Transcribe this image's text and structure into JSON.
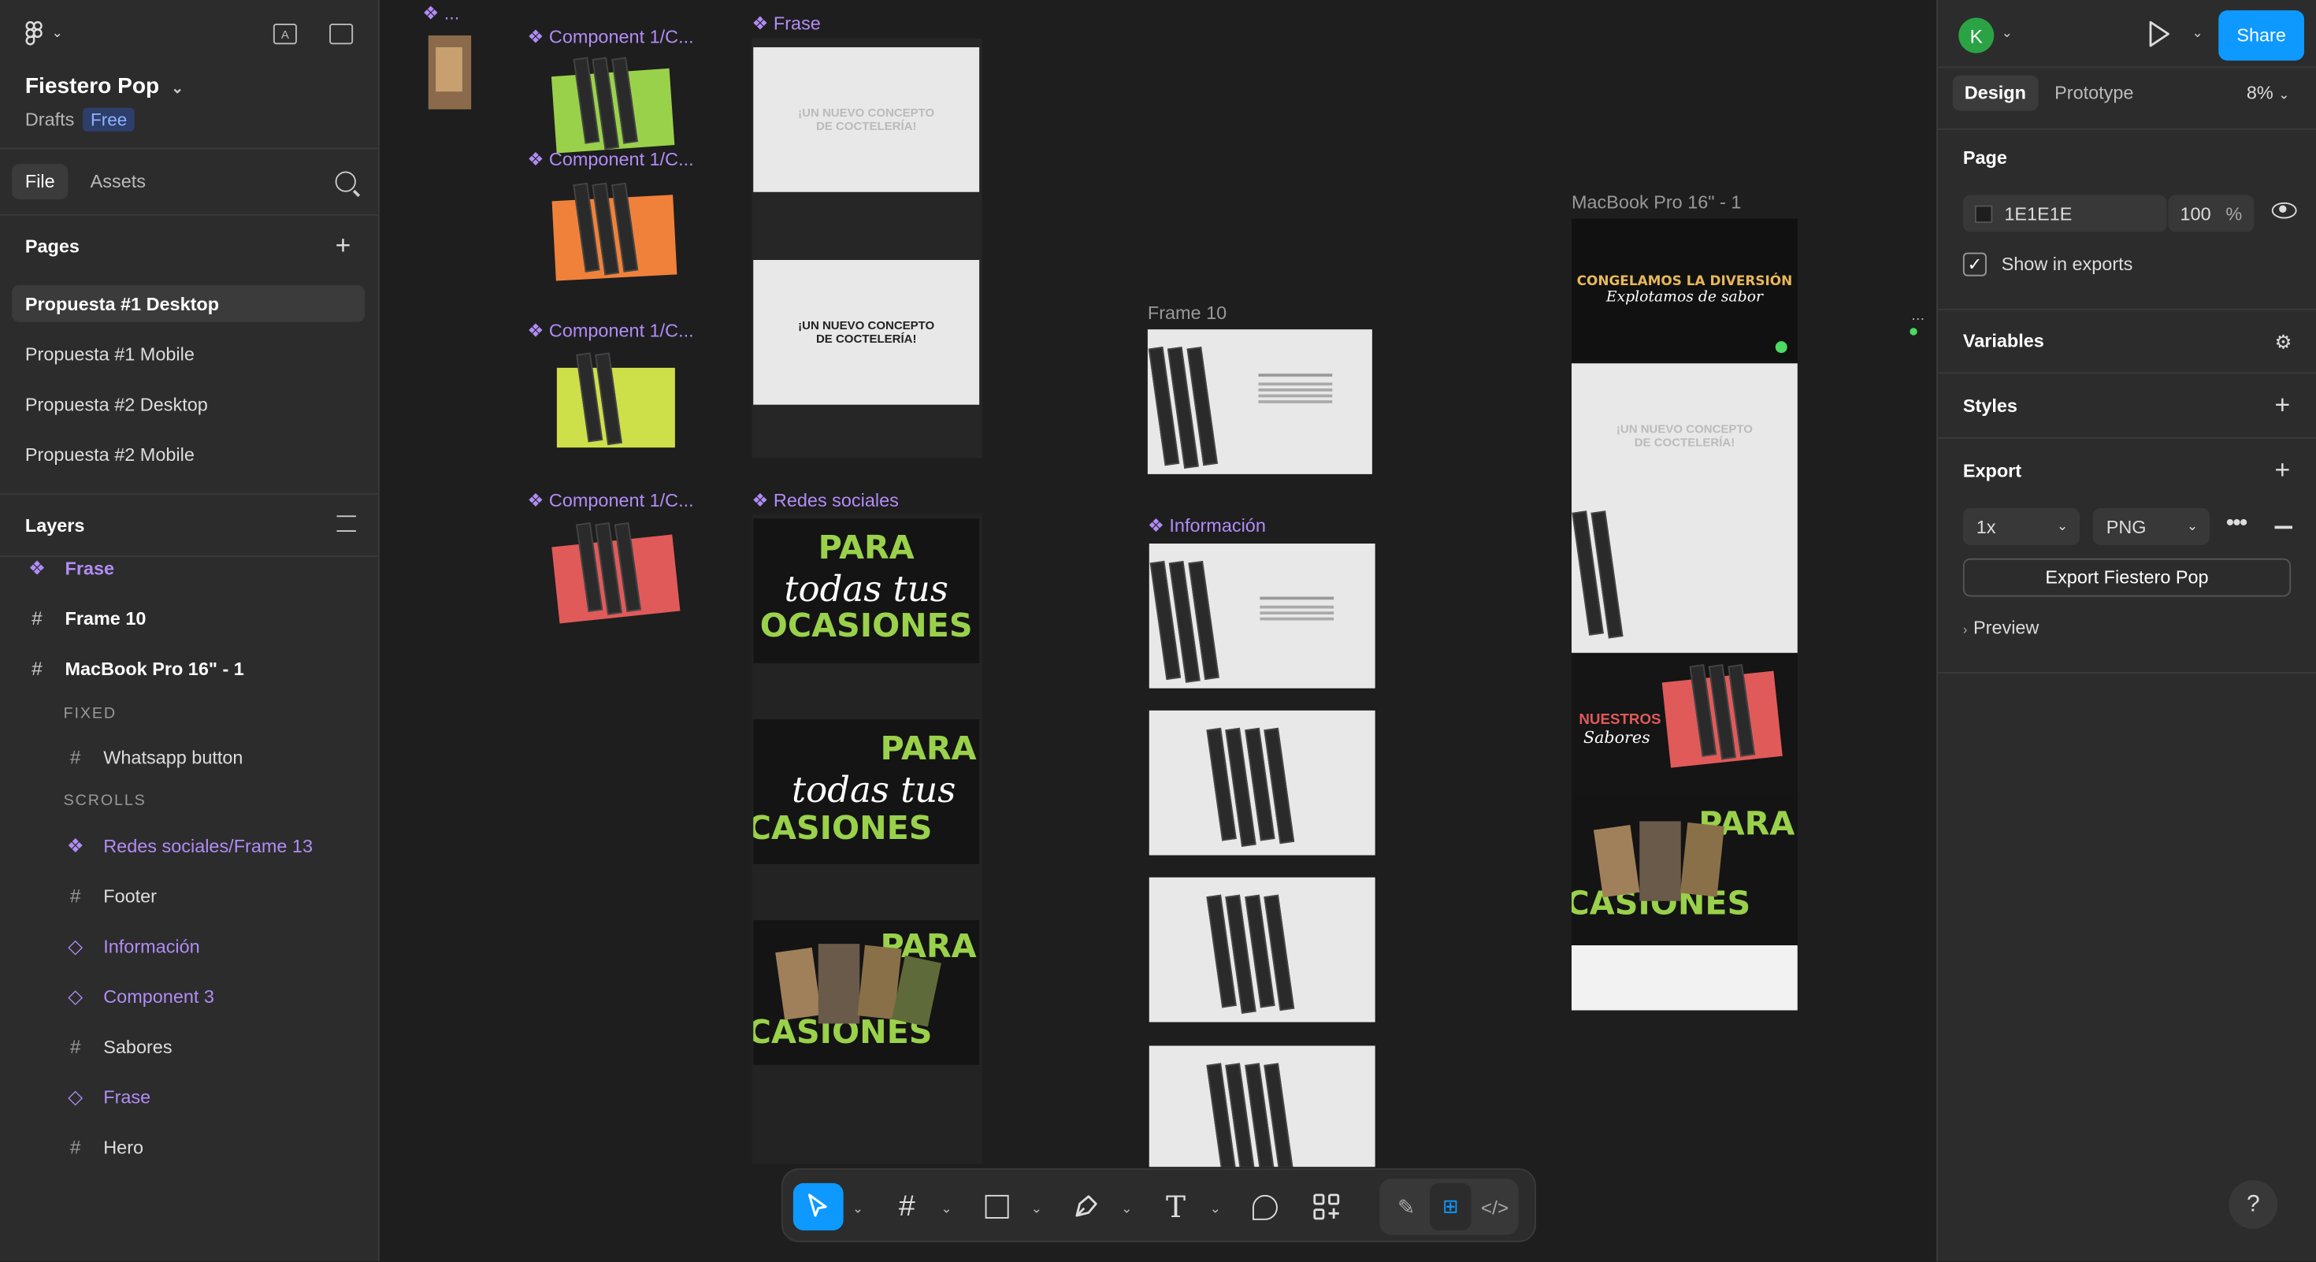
{
  "app": {
    "zoom": "8%"
  },
  "project": {
    "name": "Fiestero Pop",
    "location": "Drafts",
    "plan": "Free"
  },
  "left_tabs": {
    "file": "File",
    "assets": "Assets"
  },
  "pages": {
    "title": "Pages",
    "items": [
      "Propuesta #1 Desktop",
      "Propuesta #1 Mobile",
      "Propuesta #2 Desktop",
      "Propuesta #2 Mobile"
    ],
    "active": "Propuesta #1 Desktop"
  },
  "layers": {
    "title": "Layers",
    "top_items": [
      {
        "label": "Frase",
        "icon": "component-icon"
      },
      {
        "label": "Frame 10",
        "icon": "frame-icon"
      },
      {
        "label": "MacBook Pro 16\" - 1",
        "icon": "frame-icon"
      }
    ],
    "fixed_label": "FIXED",
    "fixed_items": [
      {
        "label": "Whatsapp button",
        "icon": "frame-icon"
      }
    ],
    "scrolls_label": "SCROLLS",
    "scroll_items": [
      {
        "label": "Redes sociales/Frame 13",
        "icon": "component-icon"
      },
      {
        "label": "Footer",
        "icon": "frame-icon"
      },
      {
        "label": "Información",
        "icon": "instance-icon"
      },
      {
        "label": "Component 3",
        "icon": "instance-icon"
      },
      {
        "label": "Sabores",
        "icon": "frame-icon"
      },
      {
        "label": "Frase",
        "icon": "instance-icon"
      },
      {
        "label": "Hero",
        "icon": "frame-icon"
      }
    ]
  },
  "canvas": {
    "frame_labels": {
      "top_small": "...",
      "comp1": "Component 1/C...",
      "comp2": "Component 1/C...",
      "comp3": "Component 1/C...",
      "comp4": "Component 1/C...",
      "frase": "Frase",
      "redes": "Redes sociales",
      "frame10": "Frame 10",
      "informacion": "Información",
      "macbook": "MacBook Pro 16\" - 1"
    },
    "artwork_text": {
      "frase_line": "¡UN NUEVO CONCEPTO DE COCTELERÍA!",
      "para": "PARA",
      "todas_tus": "todas tus",
      "ocasiones": "OCASIONES",
      "casiones": "CASIONES",
      "hero_title": "CONGELAMOS LA DIVERSIÓN",
      "hero_sub": "Explotamos de sabor",
      "nuestros": "NUESTROS",
      "sabores": "Sabores"
    }
  },
  "right": {
    "avatar": "K",
    "share": "Share",
    "tabs": {
      "design": "Design",
      "prototype": "Prototype"
    },
    "page": {
      "title": "Page",
      "color": "1E1E1E",
      "opacity": "100",
      "percent": "%",
      "show_in_exports": "Show in exports"
    },
    "variables": "Variables",
    "styles": "Styles",
    "export": {
      "title": "Export",
      "scale": "1x",
      "format": "PNG",
      "button": "Export Fiestero Pop",
      "preview": "Preview"
    },
    "help": "?"
  },
  "colors": {
    "accent": "#0d99ff",
    "component": "#b18cf5",
    "brand_green": "#9ad14b",
    "page_bg": "#1e1e1e"
  }
}
